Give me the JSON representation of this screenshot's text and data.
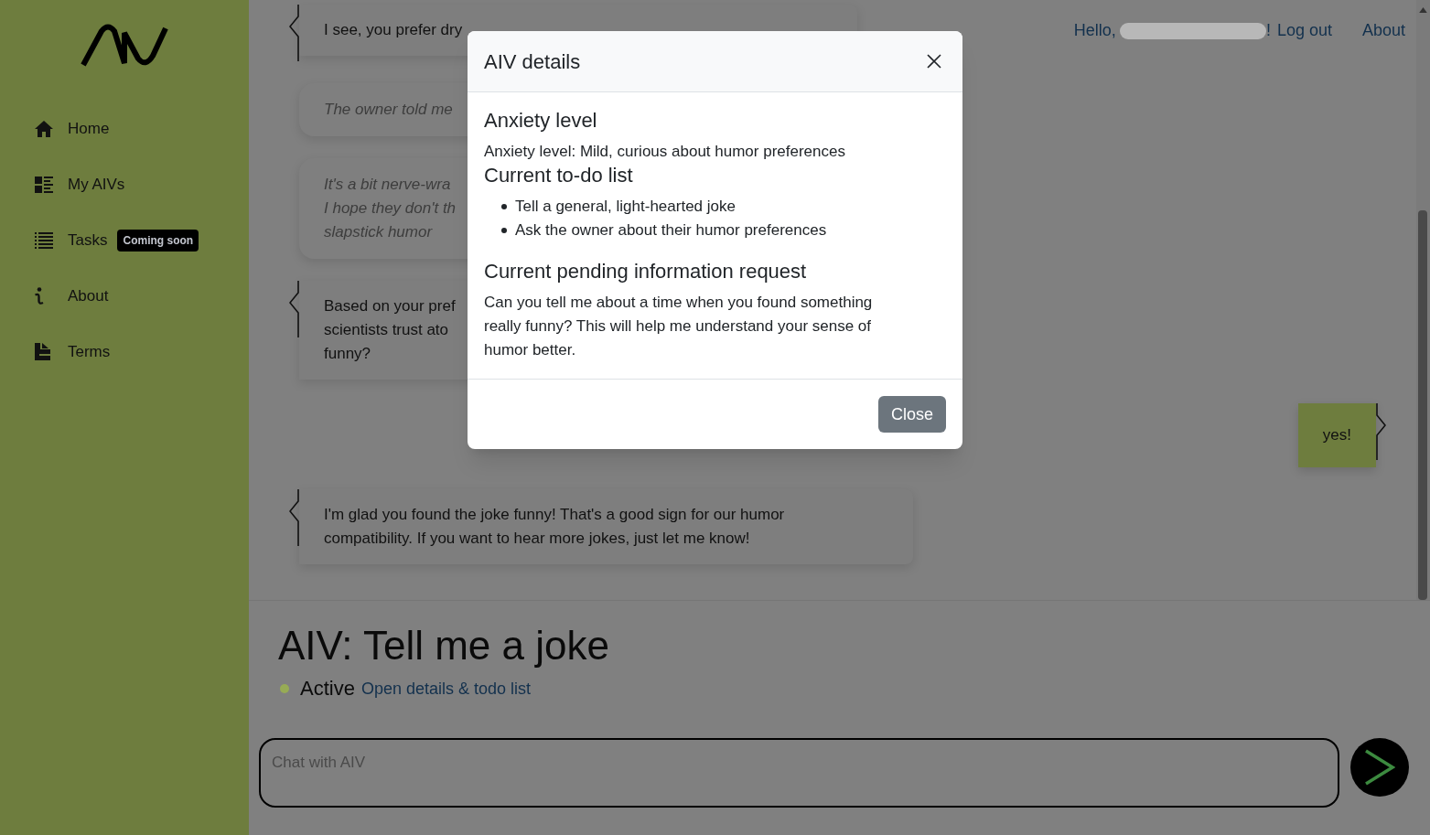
{
  "sidebar": {
    "items": [
      {
        "label": "Home"
      },
      {
        "label": "My AIVs"
      },
      {
        "label": "Tasks",
        "badge": "Coming soon"
      },
      {
        "label": "About"
      },
      {
        "label": "Terms"
      }
    ]
  },
  "header": {
    "greeting_start": "Hello,",
    "greeting_end": "!",
    "links": [
      "Log out",
      "About"
    ]
  },
  "chat": {
    "messages": [
      {
        "kind": "bot",
        "lines": [
          "I see, you prefer dry"
        ]
      },
      {
        "kind": "thought",
        "lines": [
          "The owner told me"
        ]
      },
      {
        "kind": "thought",
        "lines": [
          "It's a bit nerve-wra",
          "I hope they don't th",
          "slapstick humor"
        ]
      },
      {
        "kind": "bot",
        "lines": [
          "Based on your pref",
          "scientists trust ato",
          "funny?"
        ]
      },
      {
        "kind": "user",
        "text": "yes!"
      },
      {
        "kind": "bot",
        "text": "I'm glad you found the joke funny! That's a good sign for our humor compatibility. If you want to hear more jokes, just let me know!"
      }
    ]
  },
  "aiv": {
    "title": "AIV: Tell me a joke",
    "status": {
      "label": "Active",
      "active": true
    },
    "details_link": "Open details & todo list"
  },
  "composer": {
    "placeholder": "Chat with AIV"
  },
  "modal": {
    "title": "AIV details",
    "sections": [
      {
        "kind": "text",
        "heading": "Anxiety level",
        "text": "Anxiety level: Mild, curious about humor preferences"
      },
      {
        "kind": "list",
        "heading": "Current to-do list",
        "items": [
          "Tell a general, light-hearted joke",
          "Ask the owner about their humor preferences"
        ]
      },
      {
        "kind": "text",
        "heading": "Current pending information request",
        "text": "Can you tell me about a time when you found something really funny? This will help me understand your sense of humor better."
      }
    ],
    "close_label": "Close"
  }
}
